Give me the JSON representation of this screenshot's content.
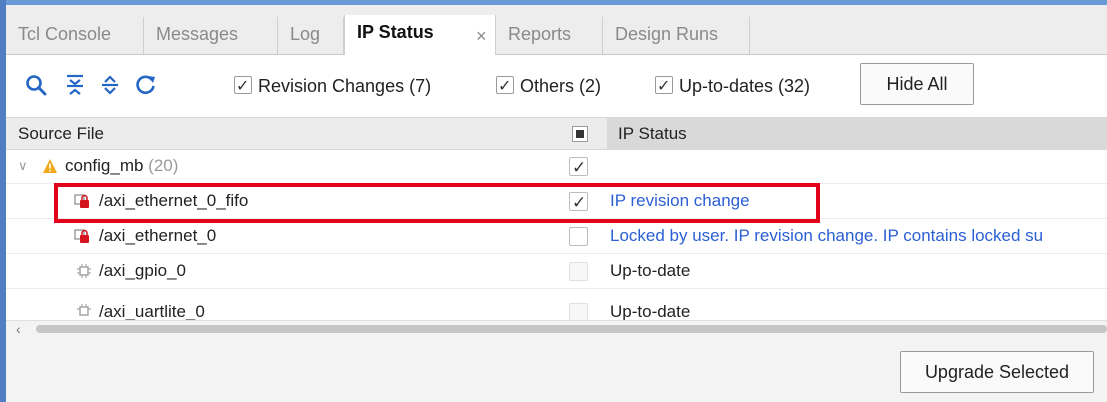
{
  "tabs": [
    {
      "label": "Tcl Console",
      "active": false
    },
    {
      "label": "Messages",
      "active": false
    },
    {
      "label": "Log",
      "active": false
    },
    {
      "label": "IP Status",
      "active": true
    },
    {
      "label": "Reports",
      "active": false
    },
    {
      "label": "Design Runs",
      "active": false
    }
  ],
  "tab_close_glyph": "×",
  "toolbar": {
    "icons": [
      "search-icon",
      "collapse-all-icon",
      "expand-all-icon",
      "refresh-icon"
    ],
    "filters": [
      {
        "label": "Revision Changes (7)",
        "checked": true
      },
      {
        "label": "Others (2)",
        "checked": true
      },
      {
        "label": "Up-to-dates (32)",
        "checked": true
      }
    ],
    "hide_all_label": "Hide All"
  },
  "table": {
    "columns": {
      "source_file": "Source File",
      "ip_status": "IP Status"
    },
    "rows": [
      {
        "name": "config_mb",
        "count": "(20)",
        "status": "",
        "checked": true,
        "icon": "warning-icon",
        "level": 0
      },
      {
        "name": "/axi_ethernet_0_fifo",
        "status": "IP revision change",
        "checked": true,
        "icon": "locked-ip-icon",
        "level": 1,
        "status_link": true
      },
      {
        "name": "/axi_ethernet_0",
        "status": "Locked by user. IP revision change. IP contains locked su",
        "checked": false,
        "icon": "locked-ip-icon",
        "level": 1,
        "status_link": true
      },
      {
        "name": "/axi_gpio_0",
        "status": "Up-to-date",
        "checked": false,
        "icon": "ip-core-icon",
        "level": 1,
        "status_link": false
      },
      {
        "name": "/axi_uartlite_0",
        "status": "Up-to-date",
        "checked": false,
        "icon": "ip-core-icon",
        "level": 1,
        "status_link": false
      }
    ]
  },
  "footer": {
    "upgrade_label": "Upgrade Selected"
  },
  "colors": {
    "accent": "#2b5fd4",
    "highlight": "#e2001a",
    "frame": "#4f7fc2"
  }
}
